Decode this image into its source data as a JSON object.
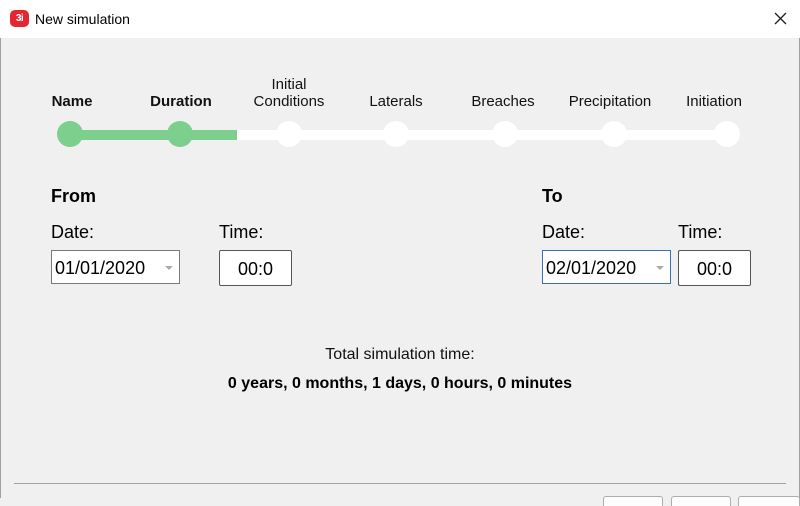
{
  "window": {
    "title": "New simulation",
    "app_icon_text": "3i"
  },
  "steps": [
    {
      "label": "Name",
      "state": "done"
    },
    {
      "label": "Duration",
      "state": "done"
    },
    {
      "label": "Initial Conditions",
      "state": "todo"
    },
    {
      "label": "Laterals",
      "state": "todo"
    },
    {
      "label": "Breaches",
      "state": "todo"
    },
    {
      "label": "Precipitation",
      "state": "todo"
    },
    {
      "label": "Initiation",
      "state": "todo"
    }
  ],
  "colors": {
    "progress_done": "#7ccf8c",
    "progress_todo": "#ffffff",
    "app_icon": "#e3262f"
  },
  "from": {
    "title": "From",
    "date_label": "Date:",
    "date_value": "01/01/2020",
    "time_label": "Time:",
    "time_value": "00:0"
  },
  "to": {
    "title": "To",
    "date_label": "Date:",
    "date_value": "02/01/2020",
    "time_label": "Time:",
    "time_value": "00:0"
  },
  "total": {
    "label": "Total simulation time:",
    "value": "0 years, 0 months, 1 days, 0 hours, 0 minutes"
  }
}
